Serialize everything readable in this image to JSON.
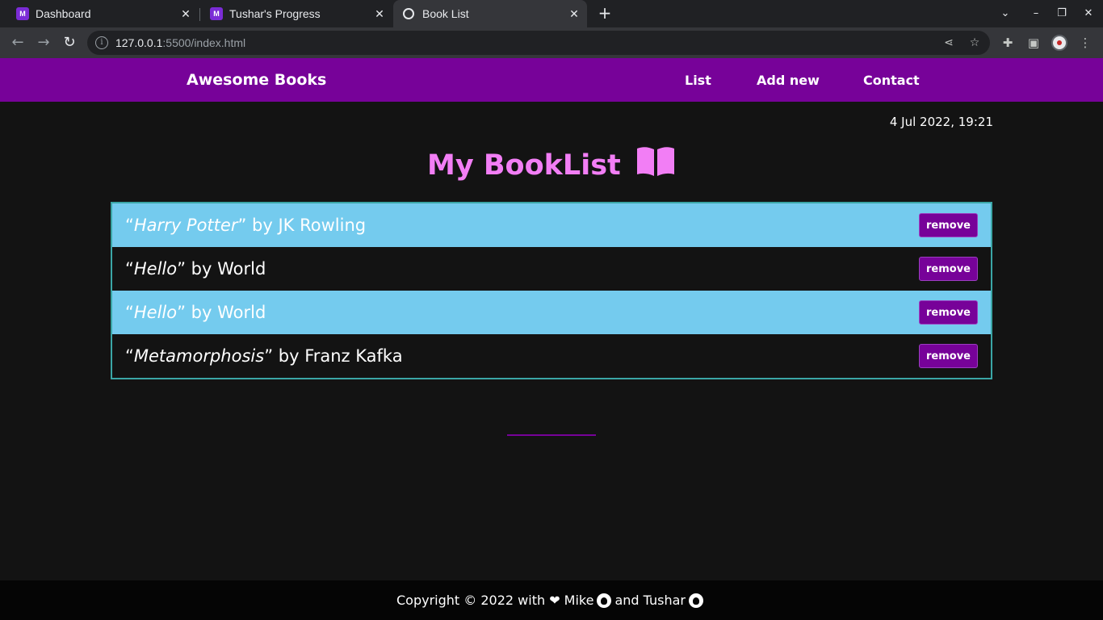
{
  "browser": {
    "tabs": [
      {
        "title": "Dashboard",
        "active": false
      },
      {
        "title": "Tushar's Progress",
        "active": false
      },
      {
        "title": "Book List",
        "active": true
      }
    ],
    "url_host": "127.0.0.1",
    "url_path": ":5500/index.html"
  },
  "nav": {
    "brand": "Awesome Books",
    "links": [
      "List",
      "Add new",
      "Contact"
    ]
  },
  "datetime": "4 Jul 2022, 19:21",
  "heading": "My BookList",
  "books": [
    {
      "title": "Harry Potter",
      "author": "JK Rowling"
    },
    {
      "title": "Hello",
      "author": "World"
    },
    {
      "title": "Hello",
      "author": "World"
    },
    {
      "title": "Metamorphosis",
      "author": "Franz Kafka"
    }
  ],
  "remove_label": "remove",
  "footer": {
    "prefix": "Copyright © 2022 with ❤ Mike",
    "middle": "and Tushar"
  },
  "colors": {
    "nav": "#770299",
    "heading": "#f27ef5",
    "row_highlight": "#74cbee",
    "background": "#131313"
  }
}
